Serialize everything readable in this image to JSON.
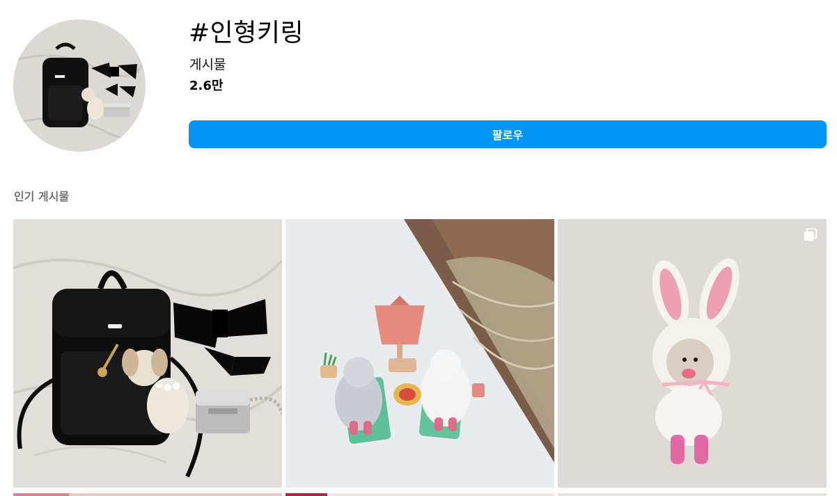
{
  "header": {
    "hashtag": "#인형키링",
    "posts_label": "게시물",
    "posts_count": "2.6만",
    "follow_label": "팔로우"
  },
  "section": {
    "title": "인기 게시물"
  },
  "colors": {
    "accent": "#0095f6",
    "secondary_text": "#737373"
  },
  "posts": [
    {
      "alt": "black backpack with plush puppy keyring",
      "multi": false
    },
    {
      "alt": "fluffy white doll keyrings on mini beach chairs",
      "multi": false
    },
    {
      "alt": "pink bunny hood plush keyring on wall",
      "multi": true
    }
  ],
  "icons": {
    "multi": "carousel-icon"
  }
}
